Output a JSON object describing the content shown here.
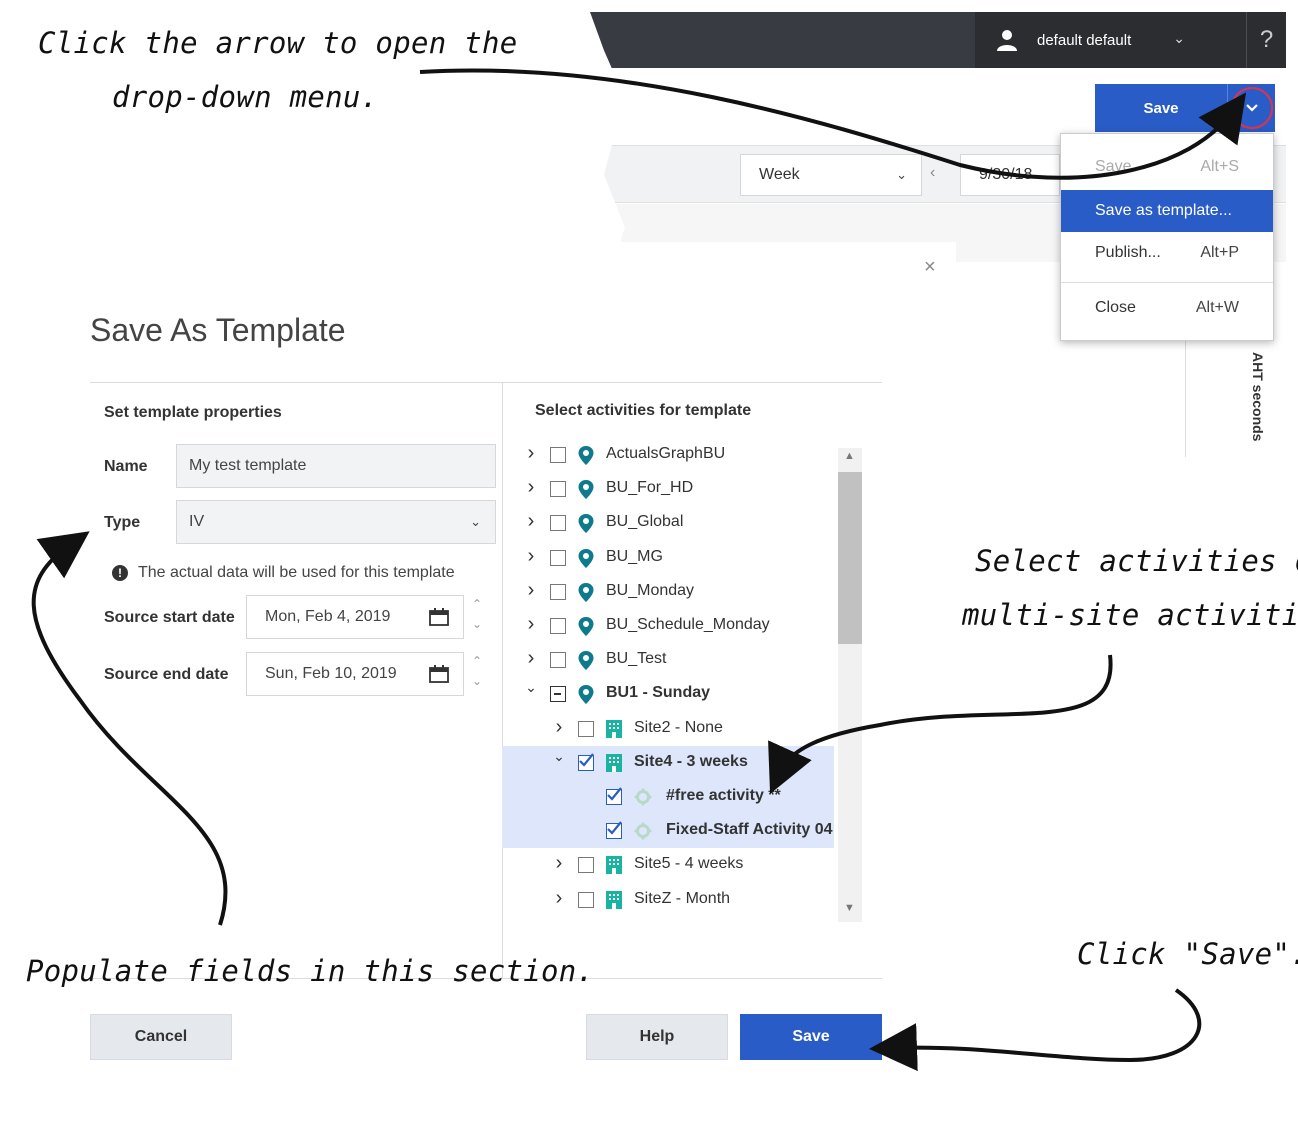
{
  "topbar": {
    "user_name": "default default",
    "help_label": "?"
  },
  "header": {
    "save_label": "Save"
  },
  "toolbar": {
    "period_select": "Week",
    "date_value": "9/30/18"
  },
  "grid": {
    "column_label": "AHT seconds"
  },
  "save_menu": {
    "items": [
      {
        "label": "Save",
        "shortcut": "Alt+S",
        "disabled": true
      },
      {
        "label": "Save as template...",
        "shortcut": "",
        "active": true
      },
      {
        "label": "Publish...",
        "shortcut": "Alt+P"
      },
      {
        "label": "Close",
        "shortcut": "Alt+W"
      }
    ]
  },
  "dialog": {
    "title": "Save As Template",
    "close_glyph": "×",
    "left_section_title": "Set template properties",
    "name_label": "Name",
    "name_value": "My test template",
    "type_label": "Type",
    "type_value": "IV",
    "info_text": "The actual data will be used for this template",
    "start_label": "Source start date",
    "start_value": "Mon, Feb 4, 2019",
    "end_label": "Source end date",
    "end_value": "Sun, Feb 10, 2019",
    "right_section_title": "Select activities for template",
    "tree": [
      {
        "label": "ActualsGraphBU",
        "level": 0,
        "expand": "collapsed",
        "check": "none",
        "icon": "location-pin-icon"
      },
      {
        "label": "BU_For_HD",
        "level": 0,
        "expand": "collapsed",
        "check": "none",
        "icon": "location-pin-icon"
      },
      {
        "label": "BU_Global",
        "level": 0,
        "expand": "collapsed",
        "check": "none",
        "icon": "location-pin-icon"
      },
      {
        "label": "BU_MG",
        "level": 0,
        "expand": "collapsed",
        "check": "none",
        "icon": "location-pin-icon"
      },
      {
        "label": "BU_Monday",
        "level": 0,
        "expand": "collapsed",
        "check": "none",
        "icon": "location-pin-icon"
      },
      {
        "label": "BU_Schedule_Monday",
        "level": 0,
        "expand": "collapsed",
        "check": "none",
        "icon": "location-pin-icon"
      },
      {
        "label": "BU_Test",
        "level": 0,
        "expand": "collapsed",
        "check": "none",
        "icon": "location-pin-icon"
      },
      {
        "label": "BU1 - Sunday",
        "level": 0,
        "expand": "expanded",
        "check": "partial",
        "icon": "location-pin-icon",
        "bold": true
      },
      {
        "label": "Site2 - None",
        "level": 1,
        "expand": "collapsed",
        "check": "none",
        "icon": "building-icon"
      },
      {
        "label": "Site4 - 3 weeks",
        "level": 1,
        "expand": "expanded",
        "check": "checked",
        "icon": "building-icon",
        "bold": true,
        "selected": true
      },
      {
        "label": "#free activity **",
        "level": 2,
        "expand": "none",
        "check": "checked",
        "icon": "gear-icon",
        "bold": true,
        "selected": true
      },
      {
        "label": "Fixed-Staff Activity 04",
        "level": 2,
        "expand": "none",
        "check": "checked",
        "icon": "gear-icon",
        "bold": true,
        "selected": true
      },
      {
        "label": "Site5 - 4 weeks",
        "level": 1,
        "expand": "collapsed",
        "check": "none",
        "icon": "building-icon"
      },
      {
        "label": "SiteZ - Month",
        "level": 1,
        "expand": "collapsed",
        "check": "none",
        "icon": "building-icon"
      }
    ],
    "cancel_label": "Cancel",
    "help_label": "Help",
    "save_label": "Save"
  },
  "annotations": {
    "arrow_line1": "Click the arrow to open the",
    "arrow_line2": "drop-down menu.",
    "select_line1": "Select activities or",
    "select_line2": "multi-site activities.",
    "populate": "Populate fields in this section.",
    "click_save": "Click \"Save\"."
  },
  "colors": {
    "accent": "#2a5cc7",
    "topbar": "#383b41",
    "pin": "#0e7a8c",
    "building": "#19b3a1",
    "selection": "#dde6fb",
    "highlight_ring": "#e0334a"
  }
}
